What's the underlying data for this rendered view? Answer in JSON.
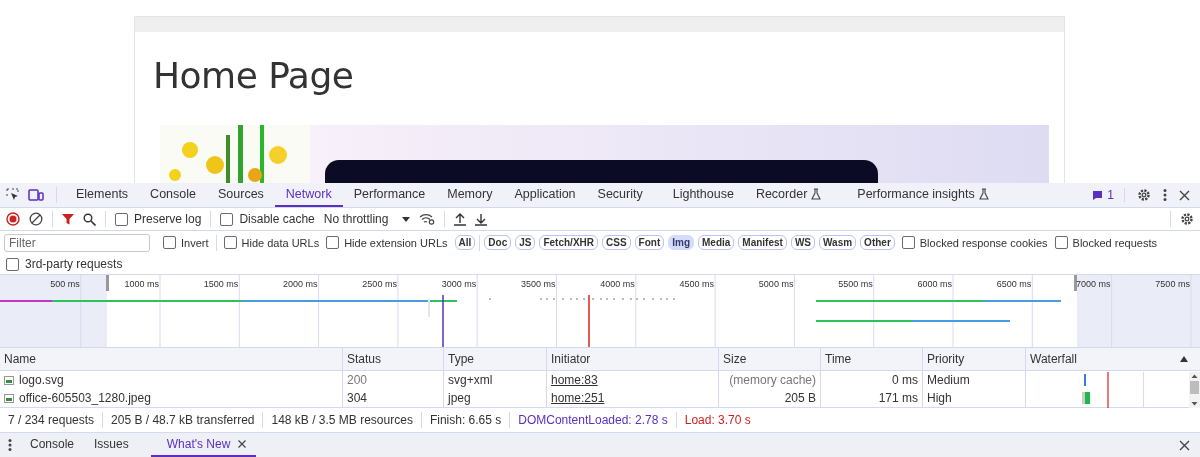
{
  "page": {
    "heading": "Home Page"
  },
  "tabs": [
    {
      "label": "Elements",
      "selected": false,
      "experimental": false
    },
    {
      "label": "Console",
      "selected": false,
      "experimental": false
    },
    {
      "label": "Sources",
      "selected": false,
      "experimental": false
    },
    {
      "label": "Network",
      "selected": true,
      "experimental": false
    },
    {
      "label": "Performance",
      "selected": false,
      "experimental": false
    },
    {
      "label": "Memory",
      "selected": false,
      "experimental": false
    },
    {
      "label": "Application",
      "selected": false,
      "experimental": false
    },
    {
      "label": "Security",
      "selected": false,
      "experimental": false
    },
    {
      "label": "Lighthouse",
      "selected": false,
      "experimental": false
    },
    {
      "label": "Recorder",
      "selected": false,
      "experimental": true
    },
    {
      "label": "Performance insights",
      "selected": false,
      "experimental": true
    }
  ],
  "issues": {
    "count": "1"
  },
  "toolbar": {
    "recording": true,
    "preserve_log": {
      "label": "Preserve log",
      "checked": false
    },
    "disable_cache": {
      "label": "Disable cache",
      "checked": false
    },
    "throttling": "No throttling"
  },
  "filter": {
    "placeholder": "Filter",
    "options": [
      {
        "label": "Invert",
        "checked": false
      },
      {
        "label": "Hide data URLs",
        "checked": false
      },
      {
        "label": "Hide extension URLs",
        "checked": false
      }
    ],
    "types": [
      {
        "label": "All",
        "selected": false
      },
      {
        "label": "Doc",
        "selected": false
      },
      {
        "label": "JS",
        "selected": false
      },
      {
        "label": "Fetch/XHR",
        "selected": false
      },
      {
        "label": "CSS",
        "selected": false
      },
      {
        "label": "Font",
        "selected": false
      },
      {
        "label": "Img",
        "selected": true
      },
      {
        "label": "Media",
        "selected": false
      },
      {
        "label": "Manifest",
        "selected": false
      },
      {
        "label": "WS",
        "selected": false
      },
      {
        "label": "Wasm",
        "selected": false
      },
      {
        "label": "Other",
        "selected": false
      }
    ],
    "options_after": [
      {
        "label": "Blocked response cookies",
        "checked": false
      },
      {
        "label": "Blocked requests",
        "checked": false
      }
    ],
    "third_party": {
      "label": "3rd-party requests",
      "checked": false
    }
  },
  "overview": {
    "ticks": [
      "500 ms",
      "1000 ms",
      "1500 ms",
      "2000 ms",
      "2500 ms",
      "3000 ms",
      "3500 ms",
      "4000 ms",
      "4500 ms",
      "5000 ms",
      "5500 ms",
      "6000 ms",
      "6500 ms",
      "7000 ms",
      "7500 ms"
    ]
  },
  "table": {
    "columns": [
      {
        "label": "Name",
        "sorted": false
      },
      {
        "label": "Status",
        "sorted": false
      },
      {
        "label": "Type",
        "sorted": false
      },
      {
        "label": "Initiator",
        "sorted": false
      },
      {
        "label": "Size",
        "sorted": false
      },
      {
        "label": "Time",
        "sorted": false
      },
      {
        "label": "Priority",
        "sorted": false
      },
      {
        "label": "Waterfall",
        "sorted": true
      }
    ],
    "rows": [
      {
        "name": "logo.svg",
        "status": "200",
        "type": "svg+xml",
        "initiator": "home:83",
        "size": "(memory cache)",
        "time": "0 ms",
        "priority": "Medium",
        "cached": true
      },
      {
        "name": "office-605503_1280.jpeg",
        "status": "304",
        "type": "jpeg",
        "initiator": "home:251",
        "size": "205 B",
        "time": "171 ms",
        "priority": "High",
        "cached": false
      }
    ]
  },
  "summary": [
    {
      "text": "7 / 234 requests",
      "color": "#333333"
    },
    {
      "text": "205 B / 48.7 kB transferred",
      "color": "#333333"
    },
    {
      "text": "148 kB / 3.5 MB resources",
      "color": "#333333"
    },
    {
      "text": "Finish: 6.65 s",
      "color": "#333333"
    },
    {
      "text": "DOMContentLoaded: 2.78 s",
      "color": "#5a2fc2"
    },
    {
      "text": "Load: 3.70 s",
      "color": "#d01f1f"
    }
  ],
  "drawer": {
    "tabs": [
      {
        "label": "Console",
        "selected": false,
        "closable": false
      },
      {
        "label": "Issues",
        "selected": false,
        "closable": false
      },
      {
        "label": "What's New",
        "selected": true,
        "closable": true
      }
    ]
  }
}
